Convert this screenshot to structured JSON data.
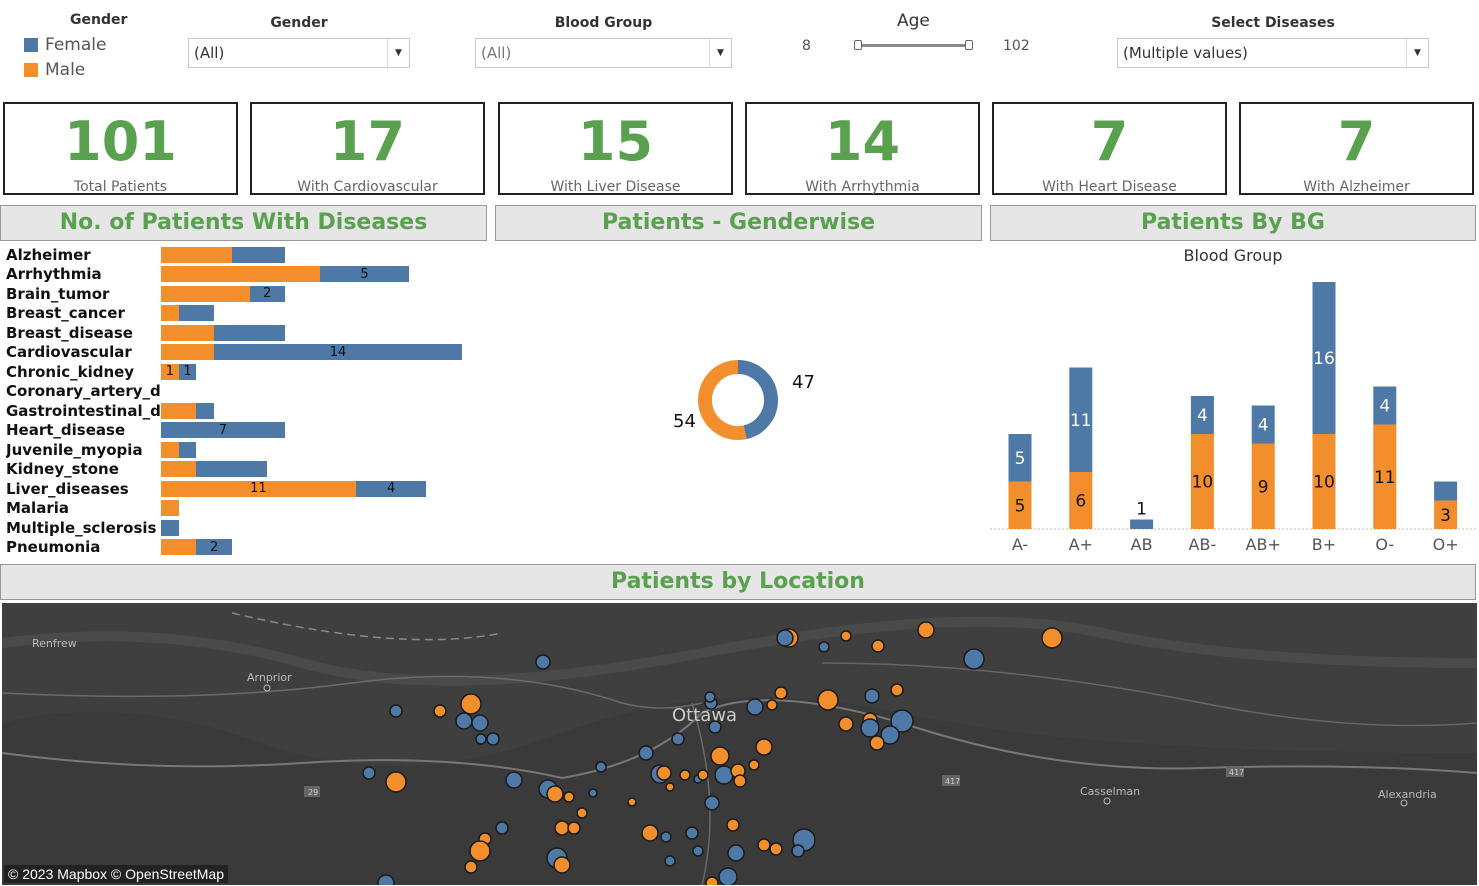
{
  "colors": {
    "female": "#4e79a7",
    "male": "#f28e2b",
    "accent": "#59a14f"
  },
  "legend": {
    "title": "Gender",
    "items": [
      {
        "label": "Female"
      },
      {
        "label": "Male"
      }
    ]
  },
  "filters": {
    "gender": {
      "label": "Gender",
      "value": "(All)"
    },
    "blood_group": {
      "label": "Blood Group",
      "value": "(All)"
    },
    "age": {
      "label": "Age",
      "min": "8",
      "max": "102"
    },
    "diseases": {
      "label": "Select Diseases",
      "value": "(Multiple values)"
    }
  },
  "kpis": [
    {
      "value": "101",
      "label": "Total Patients"
    },
    {
      "value": "17",
      "label": "With Cardiovascular"
    },
    {
      "value": "15",
      "label": "With Liver Disease"
    },
    {
      "value": "14",
      "label": "With Arrhythmia"
    },
    {
      "value": "7",
      "label": "With Heart Disease"
    },
    {
      "value": "7",
      "label": "With Alzheimer"
    }
  ],
  "sections": {
    "diseases": "No. of Patients With Diseases",
    "gender": "Patients - Genderwise",
    "bg": "Patients By BG",
    "location": "Patients by Location"
  },
  "chart_data": [
    {
      "type": "bar",
      "orientation": "horizontal",
      "stacked": true,
      "categories": [
        "Alzheimer",
        "Arrhythmia",
        "Brain_tumor",
        "Breast_cancer",
        "Breast_disease",
        "Cardiovascular",
        "Chronic_kidney",
        "Coronary_artery_d..",
        "Gastrointestinal_di..",
        "Heart_disease",
        "Juvenile_myopia",
        "Kidney_stone",
        "Liver_diseases",
        "Malaria",
        "Multiple_sclerosis",
        "Pneumonia"
      ],
      "series": [
        {
          "name": "Male",
          "values": [
            4,
            9,
            5,
            1,
            3,
            3,
            1,
            0,
            2,
            0,
            1,
            2,
            11,
            1,
            0,
            2
          ],
          "labels": [
            "",
            "",
            "",
            "",
            "",
            "",
            "1",
            "",
            "",
            "",
            "",
            "",
            "11",
            "",
            "",
            ""
          ]
        },
        {
          "name": "Female",
          "values": [
            3,
            5,
            2,
            2,
            4,
            14,
            1,
            0,
            1,
            7,
            1,
            4,
            4,
            0,
            1,
            2
          ],
          "labels": [
            "",
            "5",
            "2",
            "",
            "",
            "14",
            "1",
            "",
            "",
            "7",
            "",
            "",
            "4",
            "",
            "",
            "2"
          ]
        }
      ]
    },
    {
      "type": "pie",
      "donut": true,
      "slices": [
        {
          "name": "Female",
          "value": 47
        },
        {
          "name": "Male",
          "value": 54
        }
      ]
    },
    {
      "type": "bar",
      "stacked": true,
      "title": "Blood Group",
      "categories": [
        "A-",
        "A+",
        "AB",
        "AB-",
        "AB+",
        "B+",
        "O-",
        "O+"
      ],
      "series": [
        {
          "name": "Male",
          "values": [
            5,
            6,
            0,
            10,
            9,
            10,
            11,
            3
          ]
        },
        {
          "name": "Female",
          "values": [
            5,
            11,
            1,
            4,
            4,
            16,
            4,
            2
          ]
        }
      ],
      "labels": {
        "Male": [
          "5",
          "6",
          "",
          "10",
          "9",
          "10",
          "11",
          "3"
        ],
        "Female": [
          "5",
          "11",
          "1",
          "4",
          "4",
          "16",
          "4",
          ""
        ]
      }
    }
  ],
  "map": {
    "places": [
      "Renfrew",
      "Arnprior",
      "Ottawa",
      "Casselman",
      "Alexandria"
    ],
    "roads": [
      "29",
      "417",
      "417"
    ],
    "credit": "© 2023 Mapbox © OpenStreetMap"
  }
}
